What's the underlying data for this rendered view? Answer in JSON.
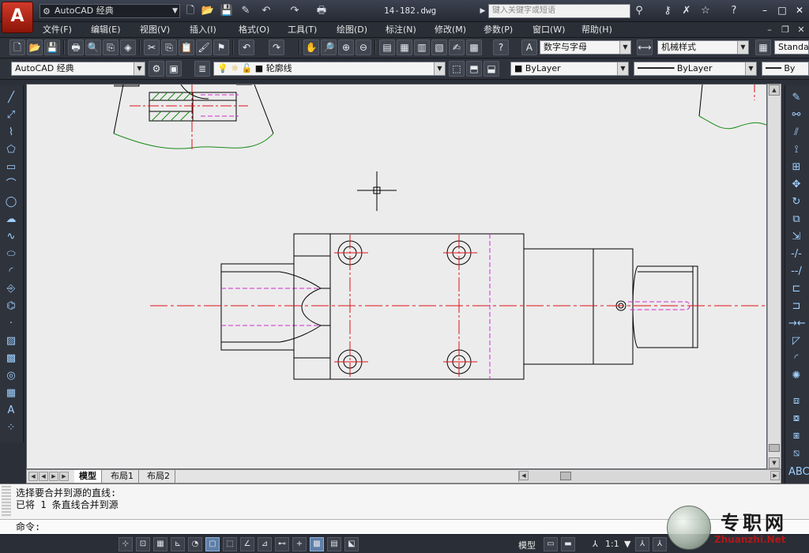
{
  "app": {
    "logo_letter": "A",
    "window_title": "14-182.dwg"
  },
  "title_bar": {
    "workspace": "AutoCAD 经典",
    "search_placeholder": "键入关键字或短语",
    "help_label": "?",
    "icons": [
      "new-icon",
      "open-icon",
      "save-icon",
      "saveas-icon",
      "undo-icon",
      "redo-icon",
      "plot-icon",
      "binoculars-icon",
      "key-icon",
      "exchange-icon",
      "star-icon",
      "help-icon"
    ]
  },
  "window_controls": {
    "minimize": "–",
    "maximize": "□",
    "close": "✕"
  },
  "menu": {
    "items": [
      "文件(F)",
      "编辑(E)",
      "视图(V)",
      "插入(I)",
      "格式(O)",
      "工具(T)",
      "绘图(D)",
      "标注(N)",
      "修改(M)",
      "参数(P)",
      "窗口(W)",
      "帮助(H)"
    ],
    "mdi": {
      "minimize": "–",
      "restore": "❐",
      "close": "✕"
    }
  },
  "standard_toolbar": {
    "text_style": "数字与字母",
    "dim_style": "机械样式",
    "table_style": "Standa"
  },
  "layers_toolbar": {
    "workspace": "AutoCAD 经典",
    "current_layer": "轮廓线",
    "color": "ByLayer",
    "linetype": "ByLayer",
    "lineweight": "By"
  },
  "layout_tabs": {
    "tabs": [
      "模型",
      "布局1",
      "布局2"
    ],
    "active": "模型"
  },
  "command": {
    "history": [
      "选择要合并到源的直线:",
      "已将 1 条直线合并到源"
    ],
    "prompt": "命令:"
  },
  "status": {
    "model_label": "模型",
    "scale_label": "1:1",
    "toggles": [
      "snap",
      "grid",
      "ortho",
      "polar",
      "osnap",
      "3dosnap",
      "otrack",
      "ducs",
      "dyn",
      "lwt",
      "tpy",
      "qp",
      "sc"
    ]
  },
  "watermark": {
    "title": "专职网",
    "url": "Zhuanzhi.Net"
  },
  "colors": {
    "centerline": "#e0121a",
    "hidden_line": "#d42ad4",
    "outline": "#000000",
    "breakline": "#1a8a1a",
    "canvas_bg": "#ececec",
    "autocad_red": "#c52b1b"
  }
}
